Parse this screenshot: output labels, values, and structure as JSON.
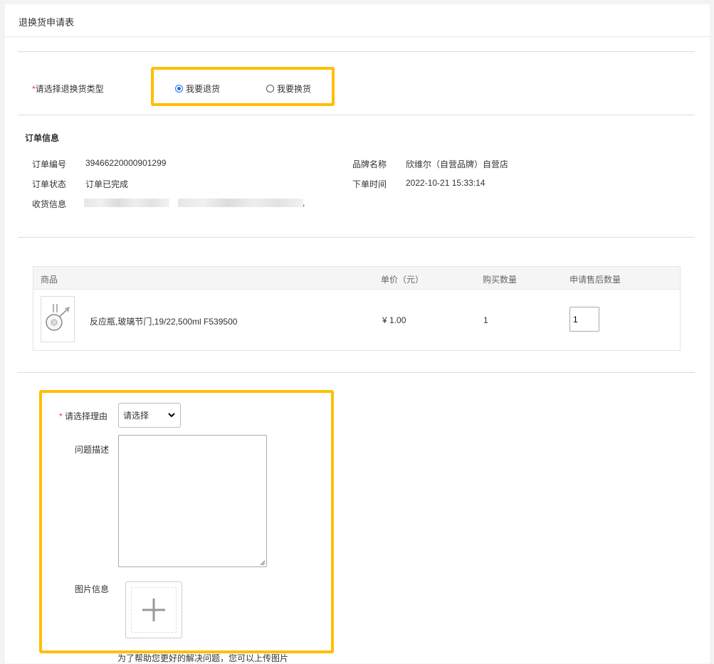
{
  "page": {
    "title": "退换货申请表"
  },
  "type_select": {
    "required_mark": "*",
    "label": "请选择退换货类型",
    "options": [
      {
        "label": "我要退货",
        "checked": true
      },
      {
        "label": "我要换货",
        "checked": false
      }
    ]
  },
  "order_info": {
    "title": "订单信息",
    "order_no_label": "订单编号",
    "order_no": "39466220000901299",
    "brand_label": "品牌名称",
    "brand": "欣维尔（自营品牌）自营店",
    "status_label": "订单状态",
    "status": "订单已完成",
    "order_time_label": "下单时间",
    "order_time": "2022-10-21 15:33:14",
    "receiver_label": "收货信息",
    "receiver_trailing": ","
  },
  "product_table": {
    "headers": [
      "商品",
      "单价（元）",
      "购买数量",
      "申请售后数量"
    ],
    "rows": [
      {
        "name": "反应瓶,玻璃节门,19/22,500ml F539500",
        "price": "¥ 1.00",
        "quantity": "1",
        "apply_quantity": "1"
      }
    ]
  },
  "reason_form": {
    "required_mark": "*",
    "reason_label": "请选择理由",
    "reason_value": "请选择",
    "description_label": "问题描述",
    "image_label": "图片信息",
    "upload_hint": "为了帮助您更好的解决问题，您可以上传图片"
  },
  "colors": {
    "highlight": "#ffbe00",
    "required": "#e4393c",
    "radio_checked": "#1a73e8"
  },
  "icons": [
    "plus-icon",
    "chevron-down-icon",
    "product-thumbnail-flask"
  ]
}
